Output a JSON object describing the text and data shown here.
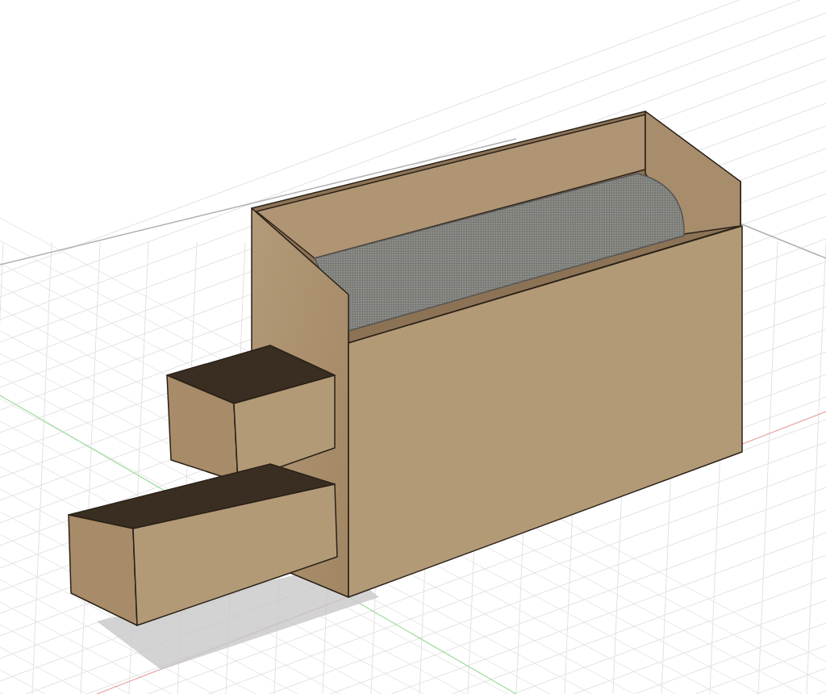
{
  "viewport": {
    "kind": "perspective",
    "model": {
      "kind": "cabinet"
    }
  }
}
